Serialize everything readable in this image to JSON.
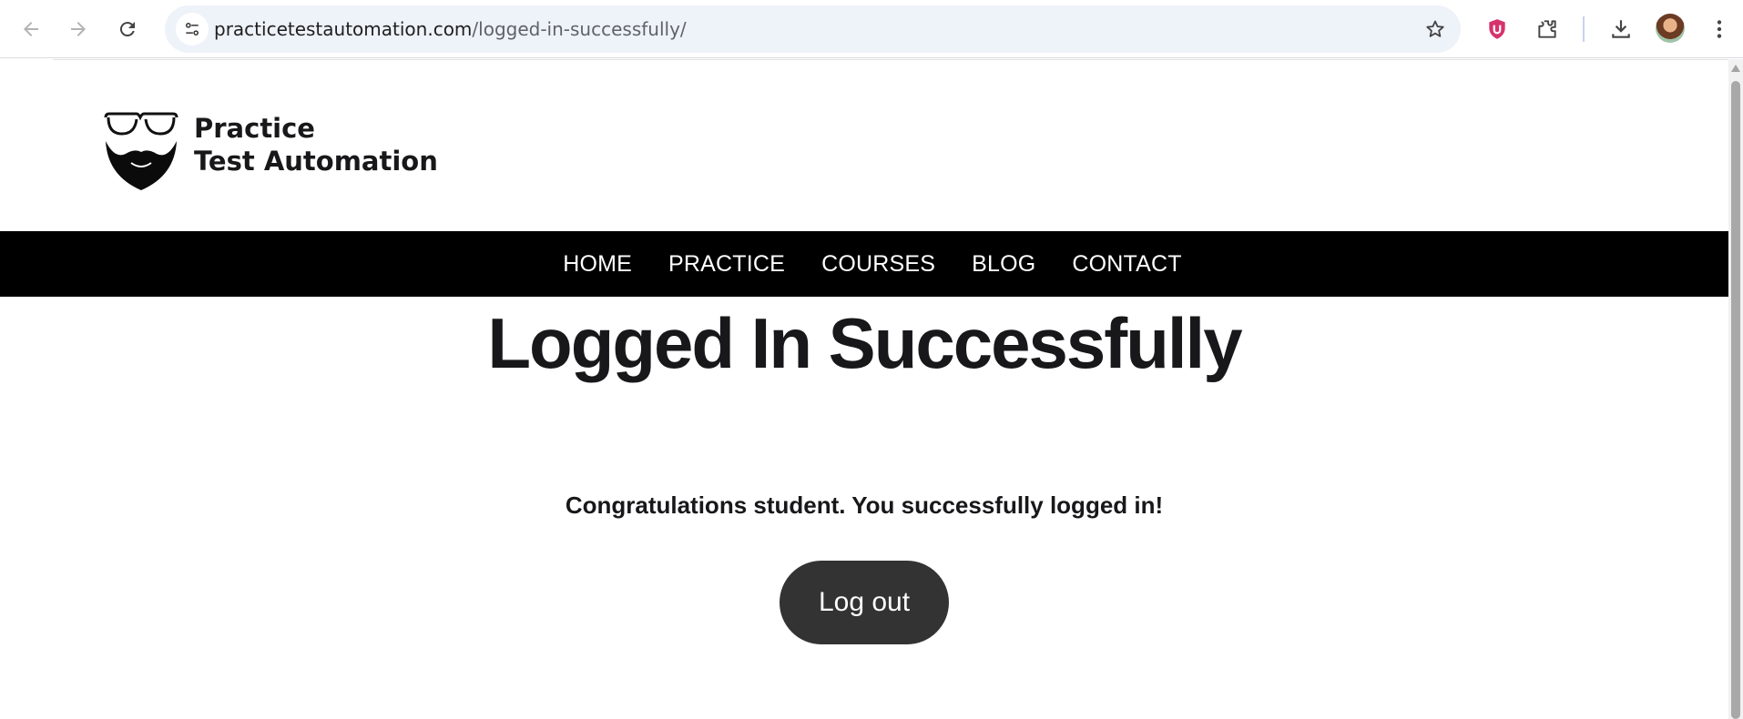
{
  "browser": {
    "url_host": "practicetestautomation.com",
    "url_path": "/logged-in-successfully/",
    "icons": [
      "back-icon",
      "forward-icon",
      "reload-icon",
      "site-info-icon",
      "star-icon",
      "ublock-icon",
      "extensions-icon",
      "download-icon",
      "profile-avatar",
      "more-icon"
    ]
  },
  "site": {
    "logo_line1": "Practice",
    "logo_line2": "Test Automation"
  },
  "nav": {
    "items": [
      "HOME",
      "PRACTICE",
      "COURSES",
      "BLOG",
      "CONTACT"
    ]
  },
  "main": {
    "title": "Logged In Successfully",
    "message": "Congratulations student. You successfully logged in!",
    "logout_label": "Log out"
  },
  "colors": {
    "nav_bg": "#000000",
    "button_bg": "#333333",
    "text": "#18181b"
  }
}
